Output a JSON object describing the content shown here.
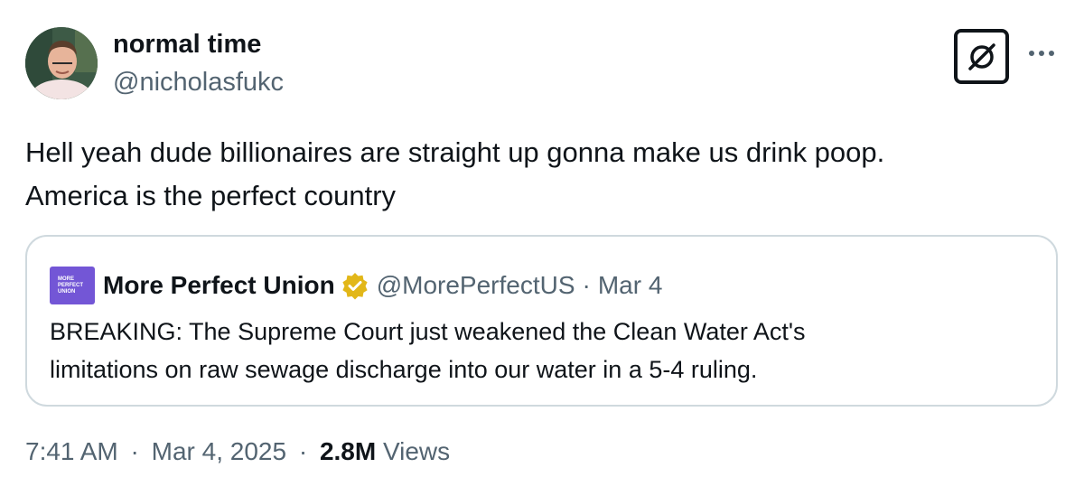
{
  "author": {
    "name": "normal time",
    "handle": "@nicholasfukc",
    "avatar_icon": "user-photo-avatar"
  },
  "actions": {
    "grok_icon": "grok-slash-circle-icon",
    "more_icon": "more-horizontal-icon"
  },
  "tweet": {
    "text_line1": "Hell yeah dude billionaires are straight up gonna make us drink poop.",
    "text_line2": "America is the perfect country"
  },
  "quote": {
    "avatar_lines": [
      "MORE",
      "PERFECT",
      "UNION"
    ],
    "avatar_color": "#7356d6",
    "name": "More Perfect Union",
    "verified_color": "#e2b719",
    "handle": "@MorePerfectUS",
    "separator": "·",
    "date": "Mar 4",
    "text_line1": "BREAKING: The Supreme Court just weakened the Clean Water Act's",
    "text_line2": "limitations on raw sewage discharge into our water in a 5-4 ruling."
  },
  "meta": {
    "time": "7:41 AM",
    "separator": "·",
    "date": "Mar 4, 2025",
    "views_count": "2.8M",
    "views_label": "Views"
  },
  "colors": {
    "text_primary": "#0f1419",
    "text_secondary": "#536471",
    "border": "#cfd9de"
  }
}
